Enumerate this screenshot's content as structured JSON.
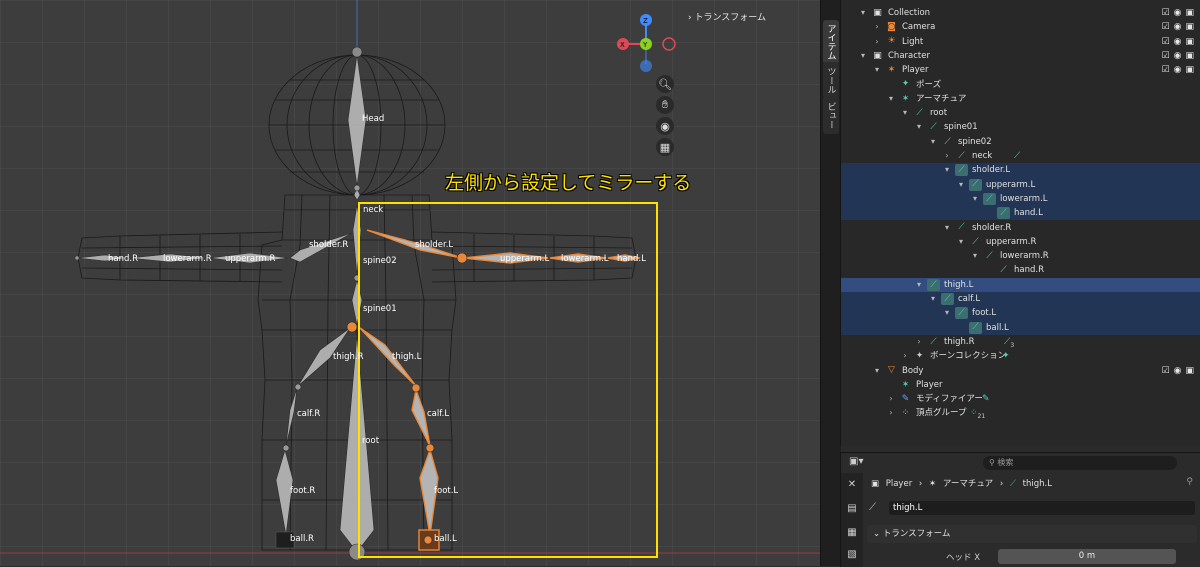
{
  "viewport": {
    "header_right": "トランスフォーム",
    "annotation": "左側から設定してミラーする",
    "gizmo": {
      "z": "Z",
      "x": "X",
      "y": "Y"
    },
    "nav_icons": [
      "zoom-icon",
      "hand-pan-icon",
      "camera-icon",
      "grid-icon"
    ],
    "bones": {
      "head": "Head",
      "neck": "neck",
      "spine02": "spine02",
      "spine01": "spine01",
      "root": "root",
      "sholder_l": "sholder.L",
      "sholder_r": "sholder.R",
      "upperarm_l": "upperarm.L",
      "upperarm_r": "upperarm.R",
      "lowerarm_l": "lowerarm.L",
      "lowerarm_r": "lowerarm.R",
      "hand_l": "hand.L",
      "hand_r": "hand.R",
      "thigh_l": "thigh.L",
      "thigh_r": "thigh.R",
      "calf_l": "calf.L",
      "calf_r": "calf.R",
      "foot_l": "foot.L",
      "foot_r": "foot.R",
      "ball_l": "ball.L",
      "ball_r": "ball.R"
    }
  },
  "side_tabs": [
    "アイテム",
    "ツール",
    "ビュー"
  ],
  "outliner": {
    "rows": [
      {
        "label": "Collection",
        "depth": 0,
        "arrow": "▾",
        "icon": "collection-icon",
        "vis": true
      },
      {
        "label": "Camera",
        "depth": 1,
        "arrow": "›",
        "icon": "camera-object-icon",
        "vis": true
      },
      {
        "label": "Light",
        "depth": 1,
        "arrow": "›",
        "icon": "light-object-icon",
        "vis": true
      },
      {
        "label": "Character",
        "depth": 0,
        "arrow": "▾",
        "icon": "collection-icon",
        "vis": true
      },
      {
        "label": "Player",
        "depth": 1,
        "arrow": "▾",
        "icon": "armature-object-icon",
        "vis": true
      },
      {
        "label": "ポーズ",
        "depth": 2,
        "arrow": "",
        "icon": "pose-icon"
      },
      {
        "label": "アーマチュア",
        "depth": 2,
        "arrow": "▾",
        "icon": "armature-data-icon"
      },
      {
        "label": "root",
        "depth": 3,
        "arrow": "▾",
        "icon": "bone-icon"
      },
      {
        "label": "spine01",
        "depth": 4,
        "arrow": "▾",
        "icon": "bone-icon"
      },
      {
        "label": "spine02",
        "depth": 5,
        "arrow": "▾",
        "icon": "bone-icon"
      },
      {
        "label": "neck",
        "depth": 6,
        "arrow": "›",
        "icon": "bone-icon",
        "extra": "bone-link-icon"
      },
      {
        "label": "sholder.L",
        "depth": 6,
        "arrow": "▾",
        "icon": "bone-icon",
        "state": "sel"
      },
      {
        "label": "upperarm.L",
        "depth": 7,
        "arrow": "▾",
        "icon": "bone-icon",
        "state": "sel"
      },
      {
        "label": "lowerarm.L",
        "depth": 8,
        "arrow": "▾",
        "icon": "bone-icon",
        "state": "sel"
      },
      {
        "label": "hand.L",
        "depth": 9,
        "arrow": "",
        "icon": "bone-icon",
        "state": "sel"
      },
      {
        "label": "sholder.R",
        "depth": 6,
        "arrow": "▾",
        "icon": "bone-icon"
      },
      {
        "label": "upperarm.R",
        "depth": 7,
        "arrow": "▾",
        "icon": "bone-icon"
      },
      {
        "label": "lowerarm.R",
        "depth": 8,
        "arrow": "▾",
        "icon": "bone-icon"
      },
      {
        "label": "hand.R",
        "depth": 9,
        "arrow": "",
        "icon": "bone-icon"
      },
      {
        "label": "thigh.L",
        "depth": 4,
        "arrow": "▾",
        "icon": "bone-icon",
        "state": "active"
      },
      {
        "label": "calf.L",
        "depth": 5,
        "arrow": "▾",
        "icon": "bone-icon",
        "state": "sel"
      },
      {
        "label": "foot.L",
        "depth": 6,
        "arrow": "▾",
        "icon": "bone-icon",
        "state": "sel"
      },
      {
        "label": "ball.L",
        "depth": 7,
        "arrow": "",
        "icon": "bone-icon",
        "state": "sel"
      },
      {
        "label": "thigh.R",
        "depth": 4,
        "arrow": "›",
        "icon": "bone-icon",
        "extra": "bone-link-icon",
        "extra_text": "3"
      },
      {
        "label": "ボーンコレクション",
        "depth": 3,
        "arrow": "›",
        "icon": "bone-collection-icon",
        "extra": "bone-collection-badge-icon"
      },
      {
        "label": "Body",
        "depth": 1,
        "arrow": "▾",
        "icon": "mesh-object-icon",
        "vis": true
      },
      {
        "label": "Player",
        "depth": 2,
        "arrow": "",
        "icon": "armature-link-icon"
      },
      {
        "label": "モディファイアー",
        "depth": 2,
        "arrow": "›",
        "icon": "wrench-icon",
        "extra": "modifier-badge-icon"
      },
      {
        "label": "頂点グループ",
        "depth": 2,
        "arrow": "›",
        "icon": "vertex-group-icon",
        "extra": "vertex-group-badge-icon",
        "extra_text": "21"
      }
    ]
  },
  "properties": {
    "search_placeholder": "検索",
    "breadcrumb": [
      "Player",
      "アーマチュア",
      "thigh.L"
    ],
    "bone_name": "thigh.L",
    "panel_title": "トランスフォーム",
    "head_x_label": "ヘッド X",
    "head_x_value": "0 m"
  },
  "colors": {
    "selected_bone": "#e8883a",
    "annotation": "#ffe000",
    "outliner_selected": "#223554",
    "outliner_active": "#334d80",
    "axis_x": "#e04757",
    "axis_y": "#8bd21c",
    "axis_z": "#3f8bff"
  }
}
